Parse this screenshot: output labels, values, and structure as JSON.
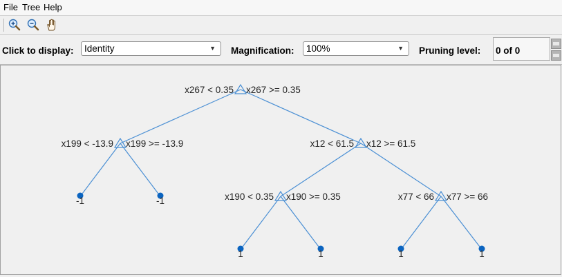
{
  "menu": {
    "items": [
      "File",
      "Tree",
      "Help"
    ]
  },
  "toolbar": {
    "zoom_in_icon": "zoom-in-icon",
    "zoom_out_icon": "zoom-out-icon",
    "pan_icon": "pan-hand-icon"
  },
  "controls": {
    "display_label": "Click to display:",
    "display_value": "Identity",
    "magnification_label": "Magnification:",
    "magnification_value": "100%",
    "pruning_label": "Pruning level:",
    "pruning_value": "0 of 0"
  },
  "colors": {
    "edge": "#4a8fd4",
    "leaf": "#0b64c0",
    "split_marker": "#4a8fd4"
  },
  "tree": {
    "nodes": [
      {
        "id": "n1",
        "type": "split",
        "left_label": "x267 < 0.35",
        "right_label": "x267 >= 0.35"
      },
      {
        "id": "n2",
        "type": "split",
        "left_label": "x199 < -13.9",
        "right_label": "x199 >= -13.9"
      },
      {
        "id": "n3",
        "type": "split",
        "left_label": "x12 < 61.5",
        "right_label": "x12 >= 61.5"
      },
      {
        "id": "n4",
        "type": "leaf",
        "label": "-1"
      },
      {
        "id": "n5",
        "type": "leaf",
        "label": "-1"
      },
      {
        "id": "n6",
        "type": "split",
        "left_label": "x190 < 0.35",
        "right_label": "x190 >= 0.35"
      },
      {
        "id": "n7",
        "type": "split",
        "left_label": "x77 < 66",
        "right_label": "x77 >= 66"
      },
      {
        "id": "n8",
        "type": "leaf",
        "label": "1"
      },
      {
        "id": "n9",
        "type": "leaf",
        "label": "1"
      },
      {
        "id": "n10",
        "type": "leaf",
        "label": "1"
      },
      {
        "id": "n11",
        "type": "leaf",
        "label": "1"
      }
    ],
    "edges": [
      [
        "n1",
        "n2"
      ],
      [
        "n1",
        "n3"
      ],
      [
        "n2",
        "n4"
      ],
      [
        "n2",
        "n5"
      ],
      [
        "n3",
        "n6"
      ],
      [
        "n3",
        "n7"
      ],
      [
        "n6",
        "n8"
      ],
      [
        "n6",
        "n9"
      ],
      [
        "n7",
        "n10"
      ],
      [
        "n7",
        "n11"
      ]
    ]
  }
}
